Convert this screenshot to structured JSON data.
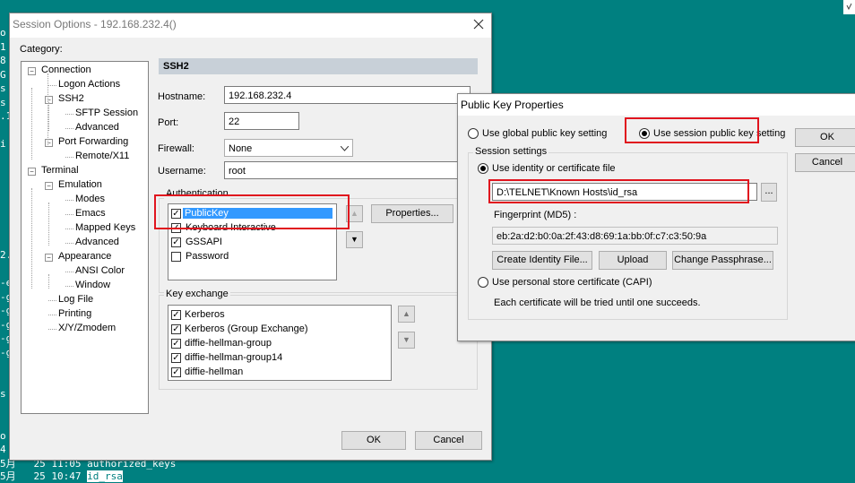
{
  "terminal": {
    "left_chars": [
      "o",
      "1",
      "8",
      "G",
      "s",
      "s",
      ".1",
      "",
      "i",
      "",
      "",
      "",
      "",
      "",
      "",
      "",
      "2.",
      "",
      "-e",
      "-g",
      "-g",
      "-g",
      "-g",
      "-g",
      "",
      "",
      "s",
      "",
      "",
      "o",
      "4"
    ],
    "bottom_line1": "5月   25 11:05 authorized_keys",
    "bottom_line2_prefix": "5月   25 10:47 ",
    "bottom_line2_highlight": "id_rsa"
  },
  "session_options": {
    "title": "Session Options - 192.168.232.4(",
    "title_suffix": ")",
    "category_label": "Category:",
    "tree": [
      {
        "label": "Connection"
      },
      {
        "label": "Logon Actions"
      },
      {
        "label": "SSH2"
      },
      {
        "label": "SFTP Session"
      },
      {
        "label": "Advanced"
      },
      {
        "label": "Port Forwarding"
      },
      {
        "label": "Remote/X11"
      },
      {
        "label": "Terminal"
      },
      {
        "label": "Emulation"
      },
      {
        "label": "Modes"
      },
      {
        "label": "Emacs"
      },
      {
        "label": "Mapped Keys"
      },
      {
        "label": "Advanced"
      },
      {
        "label": "Appearance"
      },
      {
        "label": "ANSI Color"
      },
      {
        "label": "Window"
      },
      {
        "label": "Log File"
      },
      {
        "label": "Printing"
      },
      {
        "label": "X/Y/Zmodem"
      }
    ],
    "section_header": "SSH2",
    "hostname_label": "Hostname:",
    "hostname_value": "192.168.232.4",
    "port_label": "Port:",
    "port_value": "22",
    "firewall_label": "Firewall:",
    "firewall_value": "None",
    "username_label": "Username:",
    "username_value": "root",
    "auth_group": "Authentication",
    "auth_items": [
      {
        "label": "PublicKey",
        "checked": true
      },
      {
        "label": "Keyboard Interactive",
        "checked": true
      },
      {
        "label": "GSSAPI",
        "checked": true
      },
      {
        "label": "Password",
        "checked": false
      }
    ],
    "properties_button": "Properties...",
    "kex_group": "Key exchange",
    "kex_items": [
      {
        "label": "Kerberos",
        "checked": true
      },
      {
        "label": "Kerberos (Group Exchange)",
        "checked": true
      },
      {
        "label": "diffie-hellman-group",
        "checked": true
      },
      {
        "label": "diffie-hellman-group14",
        "checked": true
      },
      {
        "label": "diffie-hellman",
        "checked": true
      }
    ],
    "ok_button": "OK",
    "cancel_button": "Cancel"
  },
  "public_key_props": {
    "title": "Public Key Properties",
    "use_global": "Use global public key setting",
    "use_session": "Use session public key setting",
    "ok_button": "OK",
    "cancel_button": "Cancel",
    "session_settings": "Session settings",
    "use_identity": "Use identity or certificate file",
    "identity_path": "D:\\TELNET\\Known Hosts\\id_rsa",
    "browse_button": "...",
    "fingerprint_label": "Fingerprint (MD5) :",
    "fingerprint_value": "eb:2a:d2:b0:0a:2f:43:d8:69:1a:bb:0f:c7:c3:50:9a",
    "create_identity": "Create Identity File...",
    "upload": "Upload",
    "change_passphrase": "Change Passphrase...",
    "use_capi": "Use personal store certificate (CAPI)",
    "capi_note": "Each certificate will be tried until one succeeds."
  },
  "colors": {
    "desktop": "#008080",
    "highlight": "#3399ff",
    "annotation_red": "#e0141e"
  }
}
